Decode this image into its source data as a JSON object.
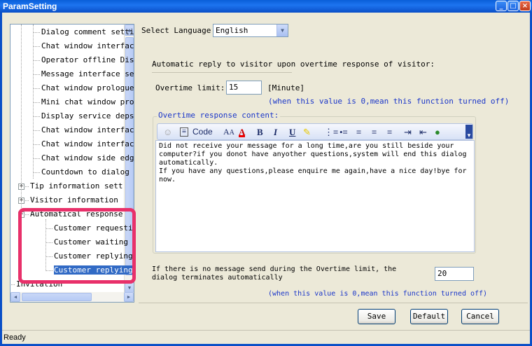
{
  "window": {
    "title": "ParamSetting"
  },
  "tree": {
    "items": [
      {
        "label": "Dialog comment setti",
        "level": 2
      },
      {
        "label": "Chat window interfac",
        "level": 2
      },
      {
        "label": "Operator offline Dis",
        "level": 2
      },
      {
        "label": "Message interface se",
        "level": 2
      },
      {
        "label": "Chat window prologue",
        "level": 2
      },
      {
        "label": "Mini chat window pro",
        "level": 2
      },
      {
        "label": "Display service deps",
        "level": 2
      },
      {
        "label": "Chat window interfac",
        "level": 2
      },
      {
        "label": "Chat window interfac",
        "level": 2
      },
      {
        "label": "Chat window side edg",
        "level": 2
      },
      {
        "label": "Countdown to dialog",
        "level": 2
      },
      {
        "label": "Tip information sett",
        "level": 1,
        "expander": "+"
      },
      {
        "label": "Visitor information",
        "level": 1,
        "expander": "+"
      },
      {
        "label": "Automatical response",
        "level": 1,
        "expander": "-"
      },
      {
        "label": "Customer requesti",
        "level": 3
      },
      {
        "label": "Customer waiting",
        "level": 3
      },
      {
        "label": "Customer replying",
        "level": 3
      },
      {
        "label": "Customer replying",
        "level": 3,
        "selected": true
      },
      {
        "label": "Invitation",
        "level": 0,
        "expander": "+"
      }
    ]
  },
  "settings": {
    "language_label": "Select Language",
    "language_value": "English",
    "section_title": "Automatic reply to visitor upon overtime response of visitor:",
    "overtime_label": "Overtime limit:",
    "overtime_value": "15",
    "overtime_unit": "[Minute]",
    "overtime_note": "(when this value is 0,mean this function turned off)",
    "content_legend": "Overtime response content:",
    "toolbar_code": "Code",
    "content_lines": [
      "Did not receive your message for a long time,are you still beside your",
      "computer?if you donot have anyother questions,system will end this dialog",
      "automatically.",
      "If you have any questions,please enquire me again,have a nice day!bye for",
      "now."
    ],
    "terminate_label_1": "If there is no message send during the Overtime limit, the",
    "terminate_label_2": "dialog terminates automatically",
    "terminate_value": "20",
    "terminate_note": "(when this value is 0,mean this function turned off)"
  },
  "buttons": {
    "save": "Save",
    "default": "Default",
    "cancel": "Cancel"
  },
  "status": {
    "text": "Ready"
  },
  "colors": {
    "title_bar": "#0a5fd8",
    "annotation": "#e8306a",
    "note_blue": "#1a36c9",
    "selection": "#316ac5"
  }
}
